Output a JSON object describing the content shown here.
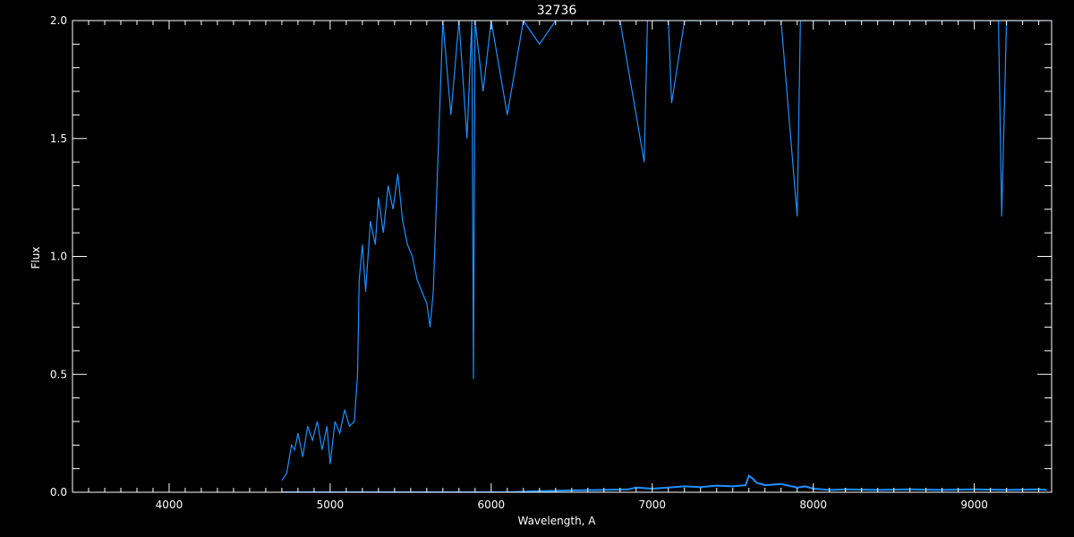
{
  "chart_data": {
    "type": "line",
    "title": "32736",
    "xlabel": "Wavelength, A",
    "ylabel": "Flux",
    "xlim": [
      3400,
      9480
    ],
    "ylim": [
      0.0,
      2.0
    ],
    "x_ticks": [
      4000,
      5000,
      6000,
      7000,
      8000,
      9000
    ],
    "x_tick_labels": [
      "4000",
      "5000",
      "6000",
      "7000",
      "8000",
      "9000"
    ],
    "y_ticks": [
      0.0,
      0.5,
      1.0,
      1.5,
      2.0
    ],
    "y_tick_labels": [
      "0.0",
      "0.5",
      "1.0",
      "1.5",
      "2.0"
    ],
    "grid": false,
    "colors": {
      "background": "#000000",
      "axes": "#ffffff",
      "line": "#1e90ff"
    },
    "series": [
      {
        "x": [
          4700,
          4730,
          4760,
          4780,
          4800,
          4830,
          4860,
          4890,
          4920,
          4950,
          4980,
          5000,
          5030,
          5060,
          5090,
          5120,
          5150,
          5170,
          5180,
          5200,
          5220,
          5250,
          5280,
          5300,
          5330,
          5360,
          5390,
          5420,
          5450,
          5480,
          5510,
          5540,
          5570,
          5600,
          5620,
          5640,
          5700,
          5750,
          5800,
          5850,
          5880,
          5890,
          5900,
          5950,
          6000,
          6100,
          6200,
          6300,
          6400,
          6500,
          6600,
          6700,
          6800,
          6950,
          6970,
          7000,
          7100,
          7120,
          7200,
          7400,
          7600,
          7800,
          7900,
          7920,
          8000,
          8200,
          8400,
          8600,
          8800,
          9000,
          9150,
          9170,
          9200,
          9300,
          9450
        ],
        "y": [
          0.05,
          0.08,
          0.2,
          0.18,
          0.25,
          0.15,
          0.28,
          0.22,
          0.3,
          0.18,
          0.28,
          0.12,
          0.3,
          0.25,
          0.35,
          0.28,
          0.3,
          0.5,
          0.9,
          1.05,
          0.85,
          1.15,
          1.05,
          1.25,
          1.1,
          1.3,
          1.2,
          1.35,
          1.15,
          1.05,
          1.0,
          0.9,
          0.85,
          0.8,
          0.7,
          0.85,
          2.0,
          1.6,
          2.0,
          1.5,
          2.0,
          0.48,
          2.0,
          1.7,
          2.0,
          1.6,
          2.0,
          1.9,
          2.0,
          2.0,
          2.0,
          2.0,
          2.0,
          1.4,
          2.0,
          2.0,
          2.0,
          1.65,
          2.0,
          2.0,
          2.0,
          2.0,
          1.17,
          2.0,
          2.0,
          2.0,
          2.0,
          2.0,
          2.0,
          2.0,
          2.0,
          1.17,
          2.0,
          2.0,
          2.0
        ]
      },
      {
        "x": [
          4700,
          4900,
          5100,
          5300,
          5500,
          5700,
          5900,
          6100,
          6300,
          6500,
          6700,
          6850,
          6900,
          7000,
          7100,
          7200,
          7300,
          7400,
          7500,
          7580,
          7600,
          7620,
          7650,
          7700,
          7800,
          7900,
          7950,
          8000,
          8100,
          8200,
          8400,
          8600,
          8800,
          9000,
          9200,
          9400,
          9450
        ],
        "y": [
          0.0,
          0.0,
          0.0,
          0.0,
          0.0,
          0.0,
          0.0,
          0.0,
          0.005,
          0.008,
          0.01,
          0.012,
          0.02,
          0.015,
          0.02,
          0.025,
          0.022,
          0.028,
          0.025,
          0.03,
          0.07,
          0.06,
          0.04,
          0.03,
          0.035,
          0.02,
          0.025,
          0.015,
          0.01,
          0.012,
          0.01,
          0.012,
          0.01,
          0.012,
          0.01,
          0.012,
          0.01
        ]
      }
    ]
  }
}
